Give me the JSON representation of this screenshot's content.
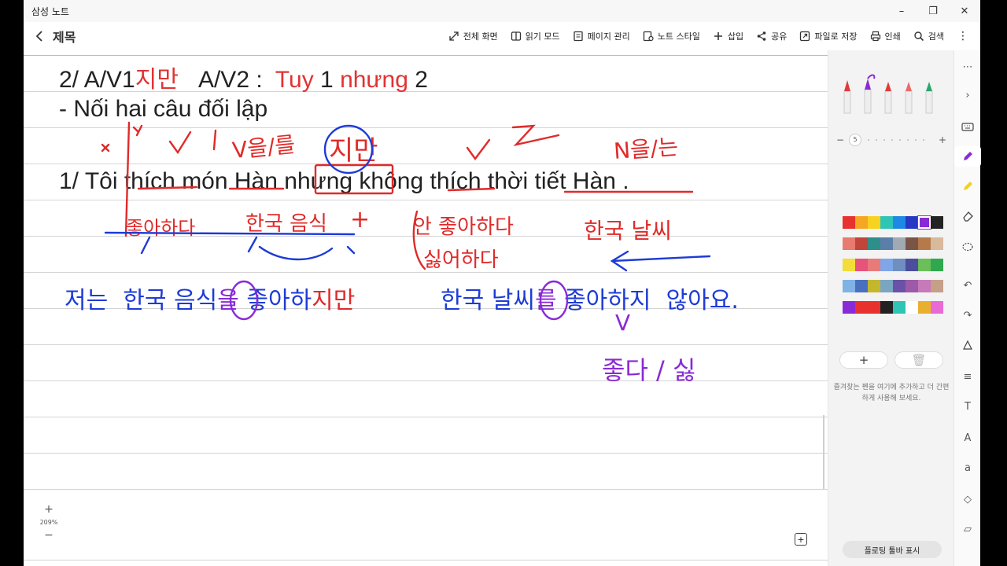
{
  "window": {
    "app_title": "삼성 노트",
    "controls": [
      "–",
      "❐",
      "✕"
    ]
  },
  "toolbar": {
    "title": "제목",
    "tools": [
      {
        "icon": "fullscreen-icon",
        "label": "전체 화면"
      },
      {
        "icon": "book-icon",
        "label": "읽기 모드"
      },
      {
        "icon": "pages-icon",
        "label": "페이지 관리"
      },
      {
        "icon": "note-style-icon",
        "label": "노트 스타일"
      },
      {
        "icon": "plus-icon",
        "label": "삽입"
      },
      {
        "icon": "share-icon",
        "label": "공유"
      },
      {
        "icon": "export-icon",
        "label": "파일로 저장"
      },
      {
        "icon": "print-icon",
        "label": "인쇄"
      },
      {
        "icon": "search-icon",
        "label": "검색"
      }
    ],
    "more": "⋮"
  },
  "note": {
    "line1_a": "2/ A/V1",
    "line1_b": "지만",
    "line1_c": "   A/V2 :  ",
    "line1_d": "Tuy",
    "line1_e": " 1 ",
    "line1_f": "nhưng",
    "line1_g": " 2",
    "line2": "- Nối hai câu đối lập",
    "line3": "1/ Tôi thích món Hàn nhưng không thích thời tiết Hàn ."
  },
  "handwriting": {
    "red_top": [
      "V을/를",
      "지만",
      "N을/는"
    ],
    "blue_gloss_left": "좋아하다",
    "blue_gloss_mid": "한국 음식",
    "red_plus": "+",
    "red_gloss_right1": "안 좋아하다",
    "red_gloss_right2": "싫어하다",
    "blue_gloss_right": "한국 날씨",
    "sentence_a": "저는  한국 음식",
    "sentence_a_particle": "을",
    "sentence_b": " 좋아하",
    "sentence_c": "지만",
    "sentence_d": "한국 날씨",
    "sentence_d_particle": "를",
    "sentence_e": " 좋아하지  않아요.",
    "sub_v": "V",
    "sub_note": "좋다 / 싫"
  },
  "zoom": {
    "plus": "+",
    "level": "209%",
    "minus": "−"
  },
  "pen_panel": {
    "pen_colors": [
      "#e03b3b",
      "#8a2ad6",
      "#e03b3b",
      "#e86a6a",
      "#2aa66a"
    ],
    "size_value": "5",
    "size_minus": "−",
    "size_plus": "+",
    "palette": [
      [
        "#e8322e",
        "#f5a623",
        "#f7d21e",
        "#2ec4b6",
        "#1e88e5",
        "#2638c4",
        "#8a2ad6",
        "#222222"
      ],
      [
        "#e87a6f",
        "#c2453a",
        "#2e8f8a",
        "#5a7fa8",
        "#a1a9b3",
        "#7a5546",
        "#b67a4a",
        "#d8b99c"
      ],
      [
        "#f2dd3a",
        "#e8537c",
        "#e97a7a",
        "#7fa6e8",
        "#6e8fbf",
        "#4d4d9e",
        "#6bbf59",
        "#2fa84f"
      ],
      [
        "#7fb2e5",
        "#4a6fbf",
        "#c4b72e",
        "#7aa6c2",
        "#6a52a8",
        "#9c5aa8",
        "#c67ab8",
        "#c4a088"
      ],
      [
        "#8a2ad6",
        "#e8322e",
        "#e8322e",
        "#222222",
        "#2ec4b6",
        "#ffffff",
        "#e8b02e",
        "#e86ad6"
      ]
    ],
    "fav_add": "+",
    "fav_delete": "🗑",
    "fav_hint": "즐겨찾는 펜을 여기에 추가하고 더 간편하게 사용해 보세요.",
    "floating_toolbar": "플로팅 툴바 표시"
  },
  "tool_strip": [
    "menu-dots-icon",
    "chevron-right-icon",
    "keyboard-icon",
    "pen-icon",
    "highlighter-icon",
    "eraser-icon",
    "lasso-icon",
    "undo-icon",
    "redo-icon",
    "shape-icon",
    "text-align-icon",
    "text-box-icon",
    "text-style-icon",
    "convert-text-icon",
    "shapes-icon",
    "layers-icon"
  ]
}
